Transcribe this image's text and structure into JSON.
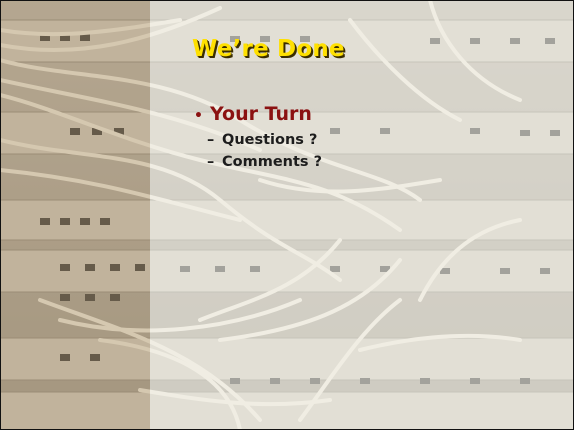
{
  "slide": {
    "title": "We’re Done",
    "bullet": {
      "marker": "•",
      "text": "Your Turn",
      "subitems": [
        {
          "marker": "–",
          "text": "Questions ?"
        },
        {
          "marker": "–",
          "text": "Comments ?"
        }
      ]
    }
  },
  "colors": {
    "title": "#ffe000",
    "bullet": "#8b1111",
    "subitem": "#1d1d1d",
    "band": "#b09670"
  }
}
